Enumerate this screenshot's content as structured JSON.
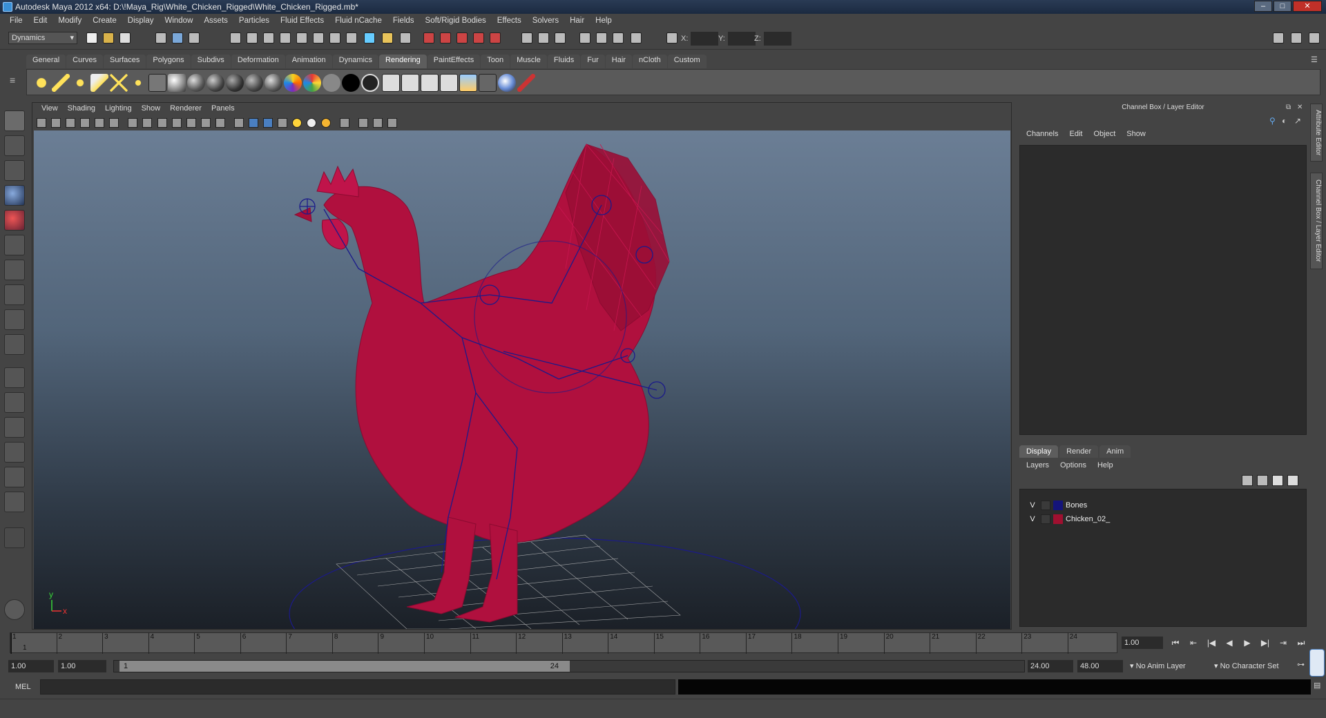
{
  "window": {
    "title": "Autodesk Maya 2012 x64: D:\\!Maya_Rig\\White_Chicken_Rigged\\White_Chicken_Rigged.mb*",
    "buttons": [
      "–",
      "□",
      "✕"
    ]
  },
  "menubar": [
    "File",
    "Edit",
    "Modify",
    "Create",
    "Display",
    "Window",
    "Assets",
    "Particles",
    "Fluid Effects",
    "Fluid nCache",
    "Fields",
    "Soft/Rigid Bodies",
    "Effects",
    "Solvers",
    "Hair",
    "Help"
  ],
  "status_line": {
    "mode": "Dynamics",
    "x_label": "X:",
    "y_label": "Y:",
    "z_label": "Z:"
  },
  "shelf": {
    "tabs": [
      "General",
      "Curves",
      "Surfaces",
      "Polygons",
      "Subdivs",
      "Deformation",
      "Animation",
      "Dynamics",
      "Rendering",
      "PaintEffects",
      "Toon",
      "Muscle",
      "Fluids",
      "Fur",
      "Hair",
      "nCloth",
      "Custom"
    ],
    "active_tab": "Rendering",
    "icons": [
      "ambient-light",
      "directional-light",
      "point-light",
      "spot-light",
      "area-light",
      "volume-light",
      "render-settings",
      "shader-ball-1",
      "shader-ball-2",
      "shader-ball-3",
      "shader-ball-4",
      "shader-ball-5",
      "shader-ball-6",
      "color-wheel",
      "grey-sphere",
      "black-sphere",
      "outlined-sphere",
      "render-view",
      "render-current",
      "ipr-render",
      "batch-render",
      "hypershade",
      "render-layers",
      "sphere-mat",
      "paint-brush"
    ]
  },
  "viewport": {
    "menu": [
      "View",
      "Shading",
      "Lighting",
      "Show",
      "Renderer",
      "Panels"
    ],
    "axis_y": "y",
    "axis_x": "x",
    "colors": {
      "mesh": "#b0103e",
      "bones": "#1b1a8a",
      "grid": "#c8c8c8"
    }
  },
  "channel_box": {
    "title": "Channel Box / Layer Editor",
    "menu": [
      "Channels",
      "Edit",
      "Object",
      "Show"
    ]
  },
  "layer_editor": {
    "tabs": [
      "Display",
      "Render",
      "Anim"
    ],
    "active_tab": "Display",
    "menu": [
      "Layers",
      "Options",
      "Help"
    ],
    "layers": [
      {
        "visible": "V",
        "name": "Bones",
        "color": "#14147a"
      },
      {
        "visible": "V",
        "name": "Chicken_02_",
        "color": "#a01030"
      }
    ]
  },
  "side_tabs": [
    "Attribute Editor",
    "Channel Box / Layer Editor"
  ],
  "timeline": {
    "ticks": [
      "1",
      "2",
      "3",
      "4",
      "5",
      "6",
      "7",
      "8",
      "9",
      "10",
      "11",
      "12",
      "13",
      "14",
      "15",
      "16",
      "17",
      "18",
      "19",
      "20",
      "21",
      "22",
      "23",
      "24"
    ],
    "current_frame_label": "1",
    "current_frame": "1.00",
    "play_buttons": [
      "⏮",
      "⇤",
      "|◀",
      "◀",
      "▶",
      "▶|",
      "⇥",
      "⏭"
    ]
  },
  "range": {
    "start": "1.00",
    "playback_start": "1.00",
    "handle_start": "1",
    "handle_end": "24",
    "playback_end": "24.00",
    "end": "48.00",
    "anim_layer": "No Anim Layer",
    "character_set": "No Character Set"
  },
  "command_line": {
    "label": "MEL"
  }
}
